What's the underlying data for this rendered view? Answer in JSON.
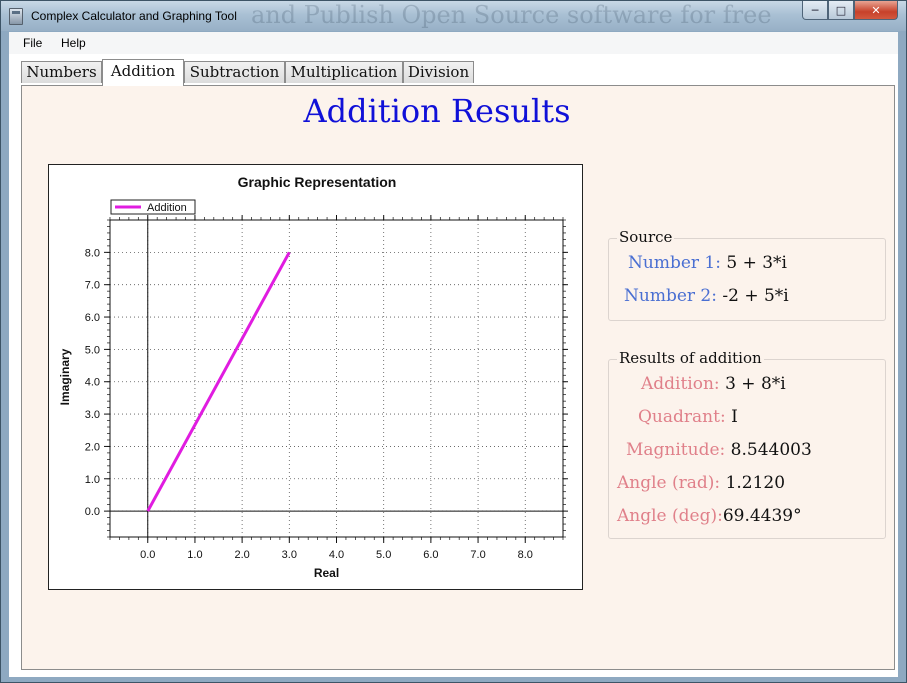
{
  "window": {
    "title": "Complex Calculator and Graphing Tool",
    "title_background_text": "and Publish Open Source software for free"
  },
  "menu": {
    "file": "File",
    "help": "Help"
  },
  "tabs": [
    "Numbers",
    "Addition",
    "Subtraction",
    "Multiplication",
    "Division"
  ],
  "active_tab": "Addition",
  "page": {
    "heading": "Addition Results"
  },
  "source": {
    "title": "Source",
    "number1_label": "Number 1:",
    "number1_value": "5 + 3*i",
    "number2_label": "Number 2:",
    "number2_value": "-2 + 5*i"
  },
  "results": {
    "title": "Results of addition",
    "addition_label": "Addition:",
    "addition_value": "3 + 8*i",
    "quadrant_label": "Quadrant:",
    "quadrant_value": "I",
    "magnitude_label": "Magnitude:",
    "magnitude_value": "8.544003",
    "angle_rad_label": "Angle (rad):",
    "angle_rad_value": "1.2120",
    "angle_deg_label": "Angle (deg):",
    "angle_deg_value": "69.4439°"
  },
  "colors": {
    "heading": "#1010d8",
    "series": "#e01ce0",
    "source_label": "#4a6fd2",
    "result_label": "#e0808a",
    "panel": "#fcf3ec"
  },
  "chart_data": {
    "type": "line",
    "title": "Graphic Representation",
    "xlabel": "Real",
    "ylabel": "Imaginary",
    "xlim": [
      -0.8,
      8.8
    ],
    "ylim": [
      -0.8,
      9.0
    ],
    "xticks": [
      "0.0",
      "1.0",
      "2.0",
      "3.0",
      "4.0",
      "5.0",
      "6.0",
      "7.0",
      "8.0"
    ],
    "yticks": [
      "0.0",
      "1.0",
      "2.0",
      "3.0",
      "4.0",
      "5.0",
      "6.0",
      "7.0",
      "8.0"
    ],
    "grid": true,
    "legend_position": "top-left",
    "series": [
      {
        "name": "Addition",
        "color": "#e01ce0",
        "x": [
          0,
          3
        ],
        "y": [
          0,
          8
        ]
      }
    ]
  }
}
